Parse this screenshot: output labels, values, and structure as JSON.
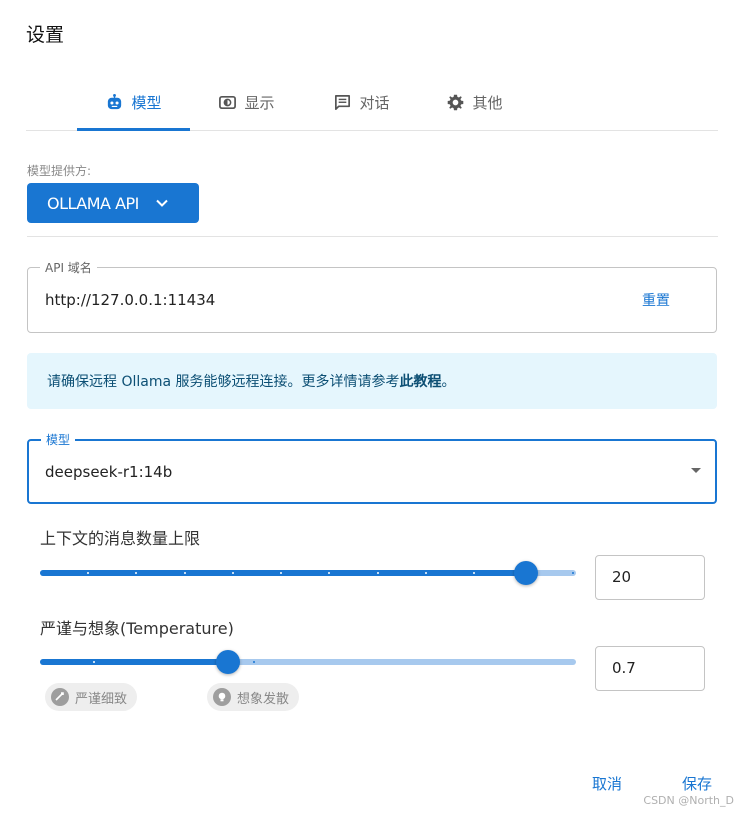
{
  "dialog": {
    "title": "设置"
  },
  "tabs": [
    {
      "label": "模型",
      "icon": "robot-icon",
      "active": true
    },
    {
      "label": "显示",
      "icon": "display-icon",
      "active": false
    },
    {
      "label": "对话",
      "icon": "chat-icon",
      "active": false
    },
    {
      "label": "其他",
      "icon": "gear-icon",
      "active": false
    }
  ],
  "provider": {
    "label": "模型提供方:",
    "value": "OLLAMA API"
  },
  "api_host": {
    "label": "API 域名",
    "value": "http://127.0.0.1:11434",
    "reset_label": "重置"
  },
  "info": {
    "text": "请确保远程 Ollama 服务能够远程连接。更多详情请参考",
    "link": "此教程",
    "suffix": "。"
  },
  "model": {
    "label": "模型",
    "value": "deepseek-r1:14b"
  },
  "context_limit": {
    "label": "上下文的消息数量上限",
    "value": "20",
    "level": 0.906
  },
  "temperature": {
    "label": "严谨与想象(Temperature)",
    "value": "0.7",
    "level": 0.35,
    "chips": [
      {
        "label": "严谨细致",
        "icon": "precise-icon"
      },
      {
        "label": "想象发散",
        "icon": "lightbulb-icon"
      }
    ]
  },
  "footer": {
    "cancel_label": "取消",
    "save_label": "保存"
  },
  "watermark": "CSDN @North_D",
  "colors": {
    "accent": "#1976d2",
    "rail": "#a7c9ee",
    "info_bg": "#e5f6fd",
    "info_text": "#0c4f74"
  }
}
